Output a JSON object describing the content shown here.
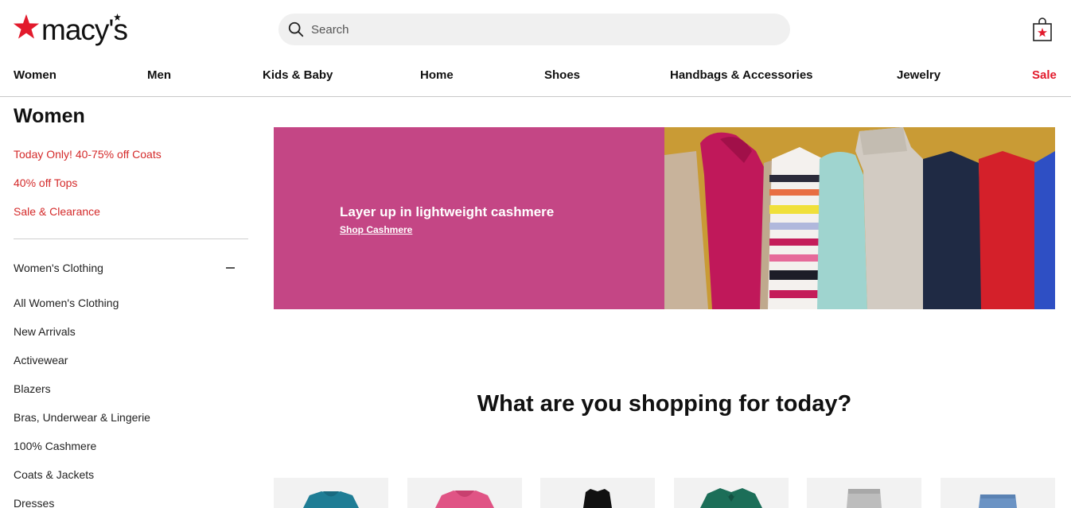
{
  "brand": {
    "name": "macy's",
    "accent": "#e21a2c"
  },
  "search": {
    "placeholder": "Search"
  },
  "header": {
    "bag_icon": "shopping-bag-star-icon"
  },
  "nav": {
    "items": [
      "Women",
      "Men",
      "Kids & Baby",
      "Home",
      "Shoes",
      "Handbags & Accessories",
      "Jewelry",
      "Sale"
    ]
  },
  "sidebar": {
    "title": "Women",
    "promos": [
      "Today Only! 40-75% off Coats",
      "40% off Tops",
      "Sale & Clearance"
    ],
    "section": {
      "label": "Women's Clothing",
      "toggle_icon": "minus-icon"
    },
    "categories": [
      "All Women's Clothing",
      "New Arrivals",
      "Activewear",
      "Blazers",
      "Bras, Underwear & Lingerie",
      "100% Cashmere",
      "Coats & Jackets",
      "Dresses"
    ]
  },
  "hero": {
    "headline": "Layer up in lightweight cashmere",
    "link": "Shop Cashmere",
    "bg_color": "#c44685"
  },
  "main": {
    "question": "What are you shopping for today?"
  }
}
